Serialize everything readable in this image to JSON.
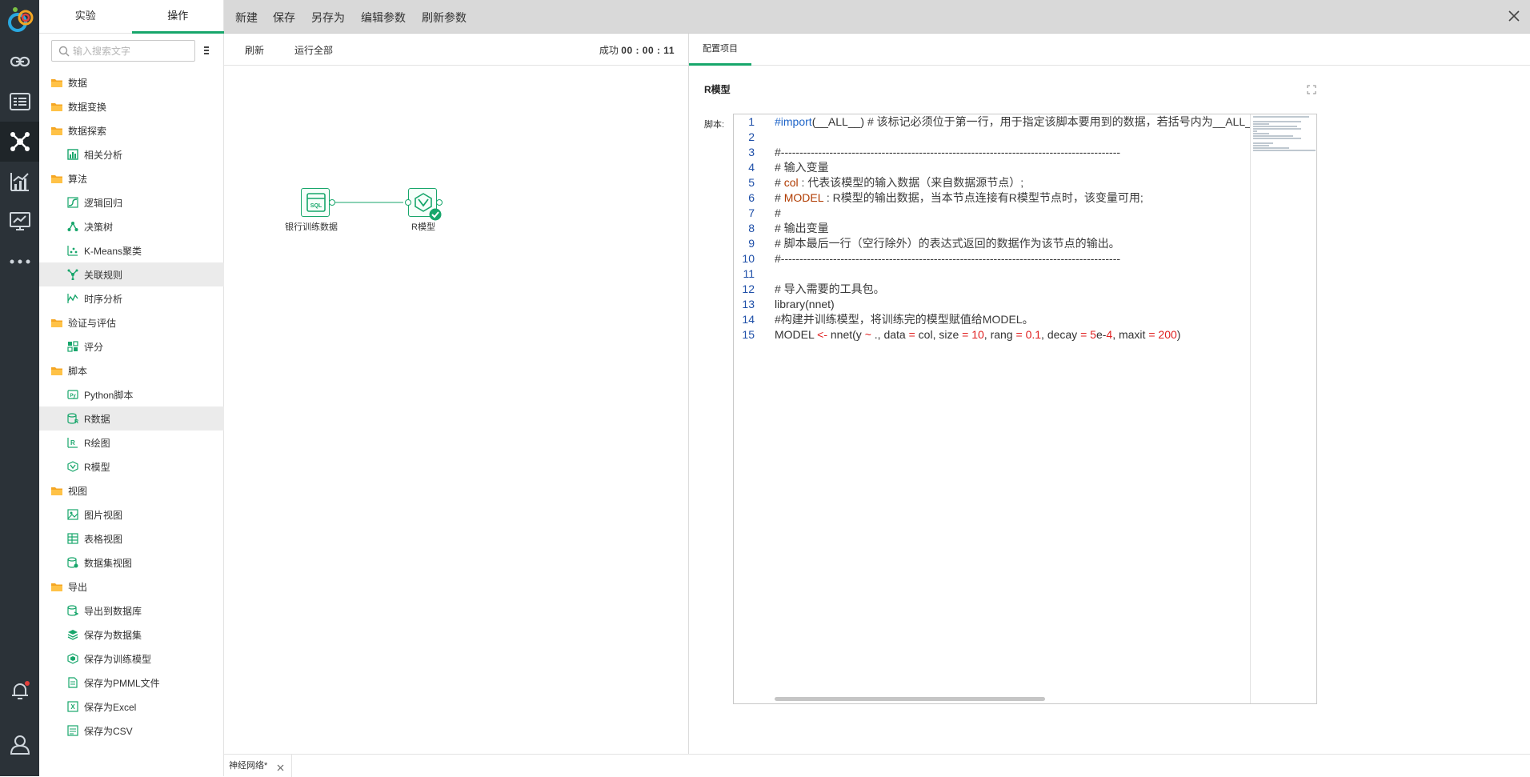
{
  "rail": {
    "icons": [
      "logo-icon",
      "link-icon",
      "list-icon",
      "workflow-icon",
      "chart-icon",
      "monitor-icon",
      "more-icon",
      "bell-icon",
      "user-icon"
    ]
  },
  "side": {
    "tabs": [
      {
        "label": "实验",
        "active": false
      },
      {
        "label": "操作",
        "active": true
      }
    ],
    "search_placeholder": "输入搜索文字",
    "tree": [
      {
        "type": "folder",
        "label": "数据"
      },
      {
        "type": "folder",
        "label": "数据变换"
      },
      {
        "type": "folder",
        "label": "数据探索"
      },
      {
        "type": "leaf",
        "label": "相关分析",
        "icon": "correlation-icon"
      },
      {
        "type": "folder",
        "label": "算法"
      },
      {
        "type": "leaf",
        "label": "逻辑回归",
        "icon": "logistic-icon"
      },
      {
        "type": "leaf",
        "label": "决策树",
        "icon": "tree-icon"
      },
      {
        "type": "leaf",
        "label": "K-Means聚类",
        "icon": "kmeans-icon"
      },
      {
        "type": "leaf",
        "label": "关联规则",
        "icon": "association-icon",
        "highlight": true
      },
      {
        "type": "leaf",
        "label": "时序分析",
        "icon": "timeseries-icon"
      },
      {
        "type": "folder",
        "label": "验证与评估"
      },
      {
        "type": "leaf",
        "label": "评分",
        "icon": "score-icon"
      },
      {
        "type": "folder",
        "label": "脚本"
      },
      {
        "type": "leaf",
        "label": "Python脚本",
        "icon": "python-icon"
      },
      {
        "type": "leaf",
        "label": "R数据",
        "icon": "r-data-icon",
        "highlight": true
      },
      {
        "type": "leaf",
        "label": "R绘图",
        "icon": "r-plot-icon"
      },
      {
        "type": "leaf",
        "label": "R模型",
        "icon": "r-model-icon"
      },
      {
        "type": "folder",
        "label": "视图"
      },
      {
        "type": "leaf",
        "label": "图片视图",
        "icon": "image-view-icon"
      },
      {
        "type": "leaf",
        "label": "表格视图",
        "icon": "table-view-icon"
      },
      {
        "type": "leaf",
        "label": "数据集视图",
        "icon": "dataset-view-icon"
      },
      {
        "type": "folder",
        "label": "导出"
      },
      {
        "type": "leaf",
        "label": "导出到数据库",
        "icon": "export-db-icon"
      },
      {
        "type": "leaf",
        "label": "保存为数据集",
        "icon": "save-dataset-icon"
      },
      {
        "type": "leaf",
        "label": "保存为训练模型",
        "icon": "save-model-icon"
      },
      {
        "type": "leaf",
        "label": "保存为PMML文件",
        "icon": "save-pmml-icon"
      },
      {
        "type": "leaf",
        "label": "保存为Excel",
        "icon": "save-excel-icon"
      },
      {
        "type": "leaf",
        "label": "保存为CSV",
        "icon": "save-csv-icon"
      }
    ]
  },
  "toolbar": {
    "new_label": "新建",
    "save_label": "保存",
    "save_as_label": "另存为",
    "edit_params_label": "编辑参数",
    "refresh_params_label": "刷新参数"
  },
  "canvas": {
    "refresh_label": "刷新",
    "run_all_label": "运行全部",
    "status_label": "成功",
    "status_time": "00 : 00 : 11",
    "nodes": [
      {
        "label": "银行训练数据",
        "icon": "sql-icon"
      },
      {
        "label": "R模型",
        "icon": "r-model-icon",
        "success": true
      }
    ]
  },
  "config": {
    "tab_label": "配置项目",
    "title": "R模型",
    "script_label": "脚本:",
    "code_lines": [
      {
        "n": "1",
        "html": "<span class='c-kw'>#import</span>(__ALL__) <span class='c-cm'># 该标记必须位于第一行，用于指定该脚本要用到的数据，若括号内为__ALL__</span>"
      },
      {
        "n": "2",
        "html": ""
      },
      {
        "n": "3",
        "html": "<span class='c-cm'>#-------------------------------------------------------------------------------------------</span>"
      },
      {
        "n": "4",
        "html": "<span class='c-cm'># 输入变量</span>"
      },
      {
        "n": "5",
        "html": "<span class='c-cm'># <span class='c-var'>col</span>              : 代表该模型的输入数据（来自数据源节点）;</span>"
      },
      {
        "n": "6",
        "html": "<span class='c-cm'># <span class='c-var'>MODEL</span>       : R模型的输出数据，当本节点连接有R模型节点时，该变量可用;</span>"
      },
      {
        "n": "7",
        "html": "<span class='c-cm'>#</span>"
      },
      {
        "n": "8",
        "html": "<span class='c-cm'># 输出变量</span>"
      },
      {
        "n": "9",
        "html": "<span class='c-cm'># 脚本最后一行（空行除外）的表达式返回的数据作为该节点的输出。</span>"
      },
      {
        "n": "10",
        "html": "<span class='c-cm'>#-------------------------------------------------------------------------------------------</span>"
      },
      {
        "n": "11",
        "html": ""
      },
      {
        "n": "12",
        "html": "<span class='c-cm'># 导入需要的工具包。</span>"
      },
      {
        "n": "13",
        "html": "library(nnet)"
      },
      {
        "n": "14",
        "html": "<span class='c-cm'>#构建并训练模型，将训练完的模型赋值给MODEL。</span>"
      },
      {
        "n": "15",
        "html": "MODEL <span class='c-op'>&lt;-</span> nnet(y <span class='c-op'>~</span> ., data <span class='c-op'>=</span> col, size <span class='c-op'>=</span> <span class='c-num'>10</span>, rang <span class='c-op'>=</span> <span class='c-num'>0.1</span>, decay <span class='c-op'>=</span> <span class='c-num'>5</span>e-<span class='c-num'>4</span>, maxit <span class='c-op'>=</span> <span class='c-num'>200</span>)"
      }
    ]
  },
  "bottom": {
    "tab_label": "神经网络*"
  },
  "colors": {
    "accent": "#17a66b",
    "rail_bg": "#2b3238",
    "toolbar_bg": "#d9d9d9",
    "folder": "#f5a623"
  }
}
